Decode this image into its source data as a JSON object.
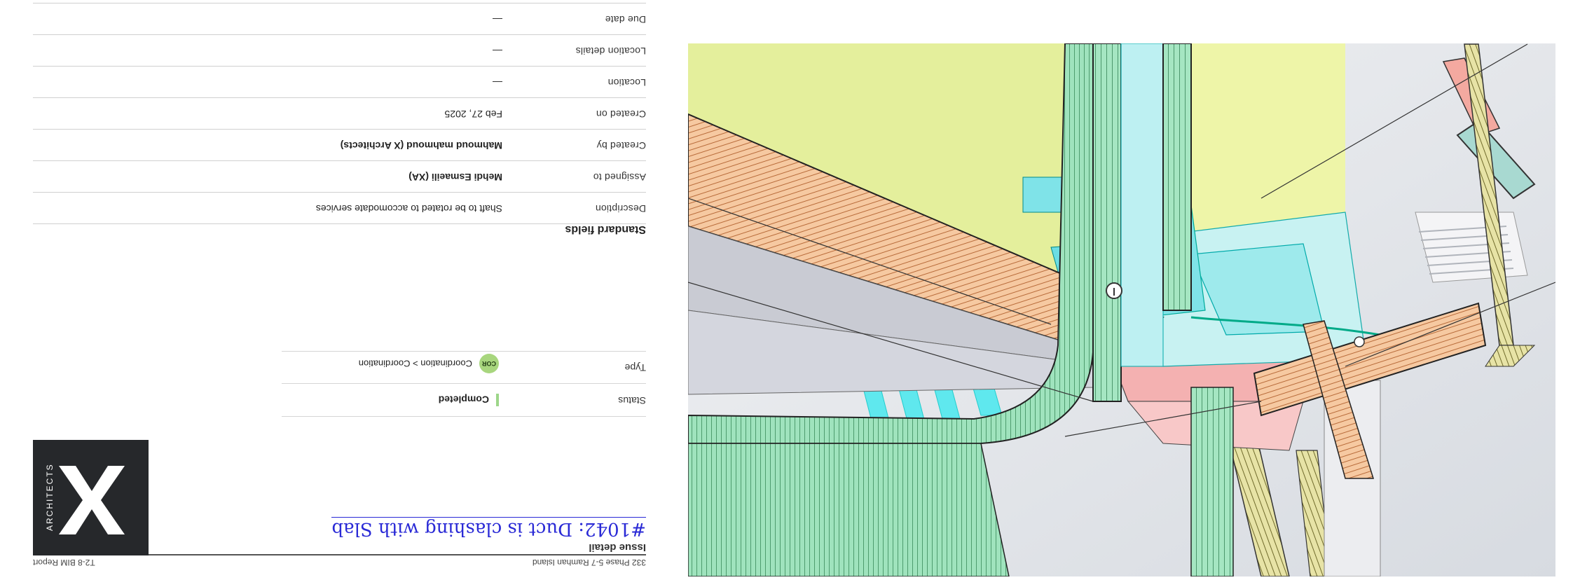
{
  "header": {
    "project": "332 Phase 5-7 Ramhan Island",
    "report_name": "T2-8 BIM Report"
  },
  "section_label": "Issue detail",
  "issue": {
    "title": "#1042: Duct is clashing with Slab"
  },
  "logo": {
    "letter": "X",
    "word": "ARCHITECTS"
  },
  "status": {
    "label": "Status",
    "value": "Completed",
    "color": "#9dd68a"
  },
  "type": {
    "label": "Type",
    "badge": "COR",
    "value": "Coordination > Coordination",
    "badge_color": "#a8d67e"
  },
  "standard_fields": {
    "title": "Standard fields",
    "rows": [
      {
        "label": "Description",
        "value": "Shaft to be rotated to accomodate services"
      },
      {
        "label": "Assigned to",
        "value": "Mehdi Esmaeili (XA)"
      },
      {
        "label": "Created by",
        "value": "Mahmoud mahmoud (X Architects)"
      },
      {
        "label": "Created on",
        "value": "Feb 27, 2025"
      },
      {
        "label": "Location",
        "value": "—"
      },
      {
        "label": "Location details",
        "value": "—"
      },
      {
        "label": "Due date",
        "value": "—"
      }
    ]
  },
  "render": {
    "description_icon": "bim-clash-render",
    "pin_icon": "issue-pin-icon"
  }
}
